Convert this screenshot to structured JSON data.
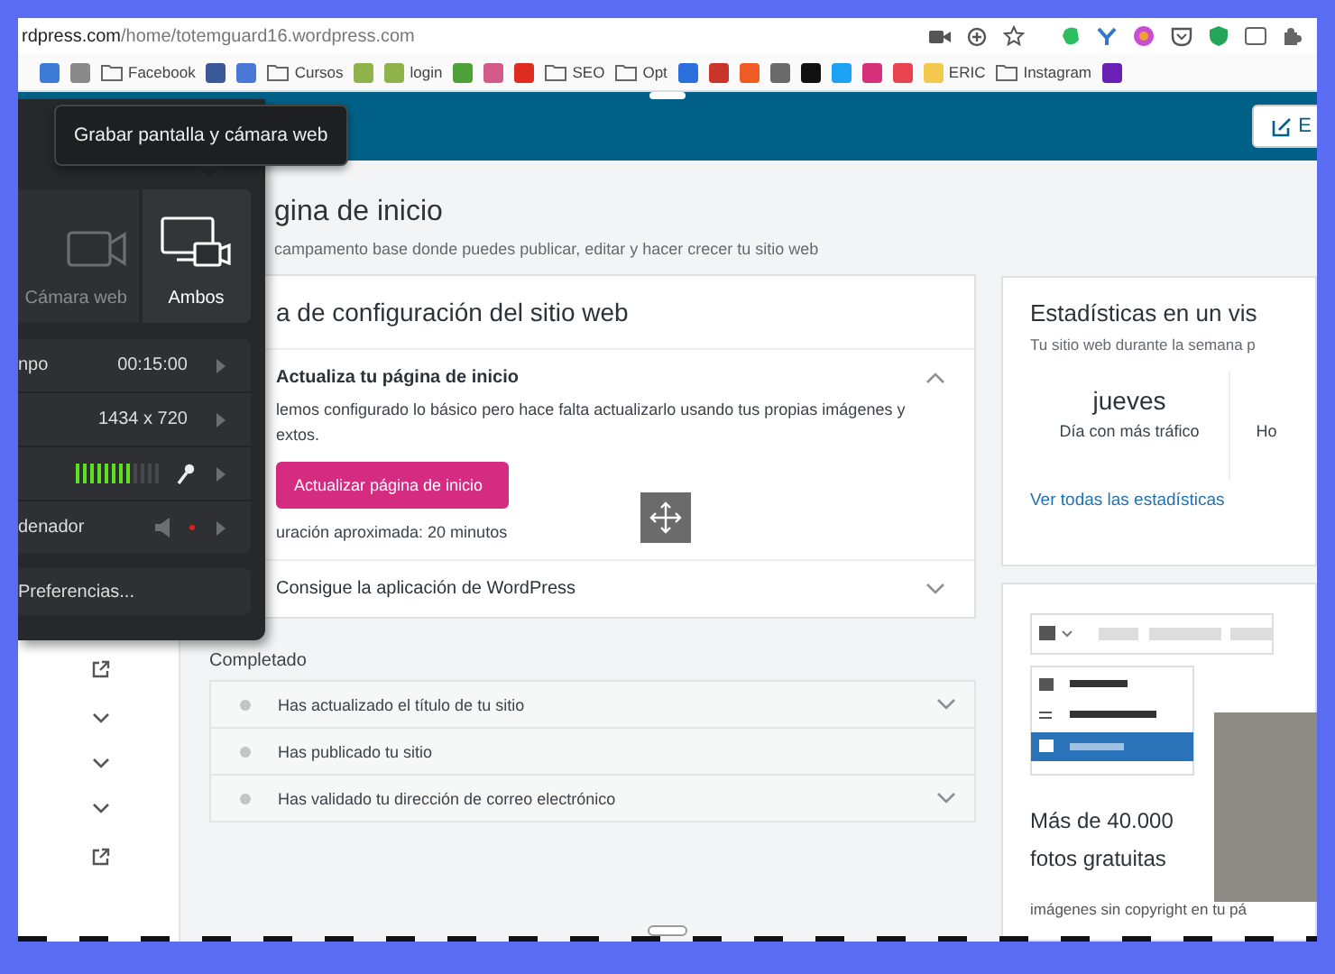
{
  "address_bar": {
    "host": "rdpress.com",
    "path": "/home/totemguard16.wordpress.com"
  },
  "bookmarks": [
    {
      "kind": "site",
      "color": "#3d7bd8"
    },
    {
      "kind": "site",
      "color": "#8a8a8a"
    },
    {
      "kind": "folder",
      "label": "Facebook"
    },
    {
      "kind": "site",
      "color": "#3b5998"
    },
    {
      "kind": "site",
      "color": "#4a78d6"
    },
    {
      "kind": "folder",
      "label": "Cursos"
    },
    {
      "kind": "site",
      "color": "#8fb34a"
    },
    {
      "kind": "site",
      "color": "#8fb34a",
      "label": "login"
    },
    {
      "kind": "site",
      "color": "#4fa23a"
    },
    {
      "kind": "site",
      "color": "#d45a8a"
    },
    {
      "kind": "site",
      "color": "#e02b20"
    },
    {
      "kind": "folder",
      "label": "SEO"
    },
    {
      "kind": "folder",
      "label": "Opt"
    },
    {
      "kind": "site",
      "color": "#2a6fdb"
    },
    {
      "kind": "site",
      "color": "#c9352a"
    },
    {
      "kind": "site",
      "color": "#f05a24"
    },
    {
      "kind": "site",
      "color": "#6a6a6a"
    },
    {
      "kind": "site",
      "color": "#111111"
    },
    {
      "kind": "site",
      "color": "#1da1f2"
    },
    {
      "kind": "site",
      "color": "#d6307a"
    },
    {
      "kind": "site",
      "color": "#e8434f"
    },
    {
      "kind": "site",
      "color": "#f2c94c",
      "label": "ERIC"
    },
    {
      "kind": "folder",
      "label": "Instagram"
    },
    {
      "kind": "site",
      "color": "#6a1fb5"
    }
  ],
  "header": {
    "button_label": "E"
  },
  "recorder": {
    "tooltip": "Grabar pantalla y cámara web",
    "modes": [
      {
        "kind": "camera",
        "label": "Cámara web",
        "selected": false
      },
      {
        "kind": "both",
        "label": "Ambos",
        "selected": true
      }
    ],
    "settings": [
      {
        "kind": "value",
        "label": "npo",
        "value": "00:15:00"
      },
      {
        "kind": "value",
        "value": "1434 x 720"
      },
      {
        "kind": "microphone",
        "level": 0.62
      },
      {
        "kind": "speaker",
        "label": "denador",
        "muted": true
      }
    ],
    "preferences": "Preferencias..."
  },
  "page": {
    "title": "gina de inicio",
    "subtitle": "campamento base donde puedes publicar, editar y hacer crecer tu sitio web"
  },
  "checklist": {
    "title": "a de configuración del sitio web",
    "tasks": [
      {
        "title": "Actualiza tu página de inicio",
        "expanded": true,
        "description": "lemos configurado lo básico pero hace falta actualizarlo usando tus propias imágenes y extos.",
        "button": "Actualizar página de inicio",
        "duration": "uración aproximada: 20 minutos"
      },
      {
        "title": "Consigue la aplicación de WordPress",
        "expanded": false
      }
    ]
  },
  "completed": {
    "title": "Completado",
    "items": [
      {
        "label": "Has actualizado el título de tu sitio",
        "expandable": true
      },
      {
        "label": "Has publicado tu sitio",
        "expandable": false
      },
      {
        "label": "Has validado tu dirección de correo electrónico",
        "expandable": true
      }
    ]
  },
  "sidebar_icons": [
    {
      "kind": "external"
    },
    {
      "kind": "chevron"
    },
    {
      "kind": "chevron"
    },
    {
      "kind": "chevron"
    },
    {
      "kind": "external"
    }
  ],
  "stats": {
    "title": "Estadísticas en un vis",
    "subtitle": "Tu sitio web durante la semana p",
    "metrics": [
      {
        "value": "jueves",
        "label": "Día con más tráfico"
      },
      {
        "label": "Ho"
      }
    ],
    "link": "Ver todas las estadísticas"
  },
  "photos_card": {
    "title": "Más de 40.000 fotos gratuitas",
    "text": "imágenes sin copyright en tu pá"
  }
}
